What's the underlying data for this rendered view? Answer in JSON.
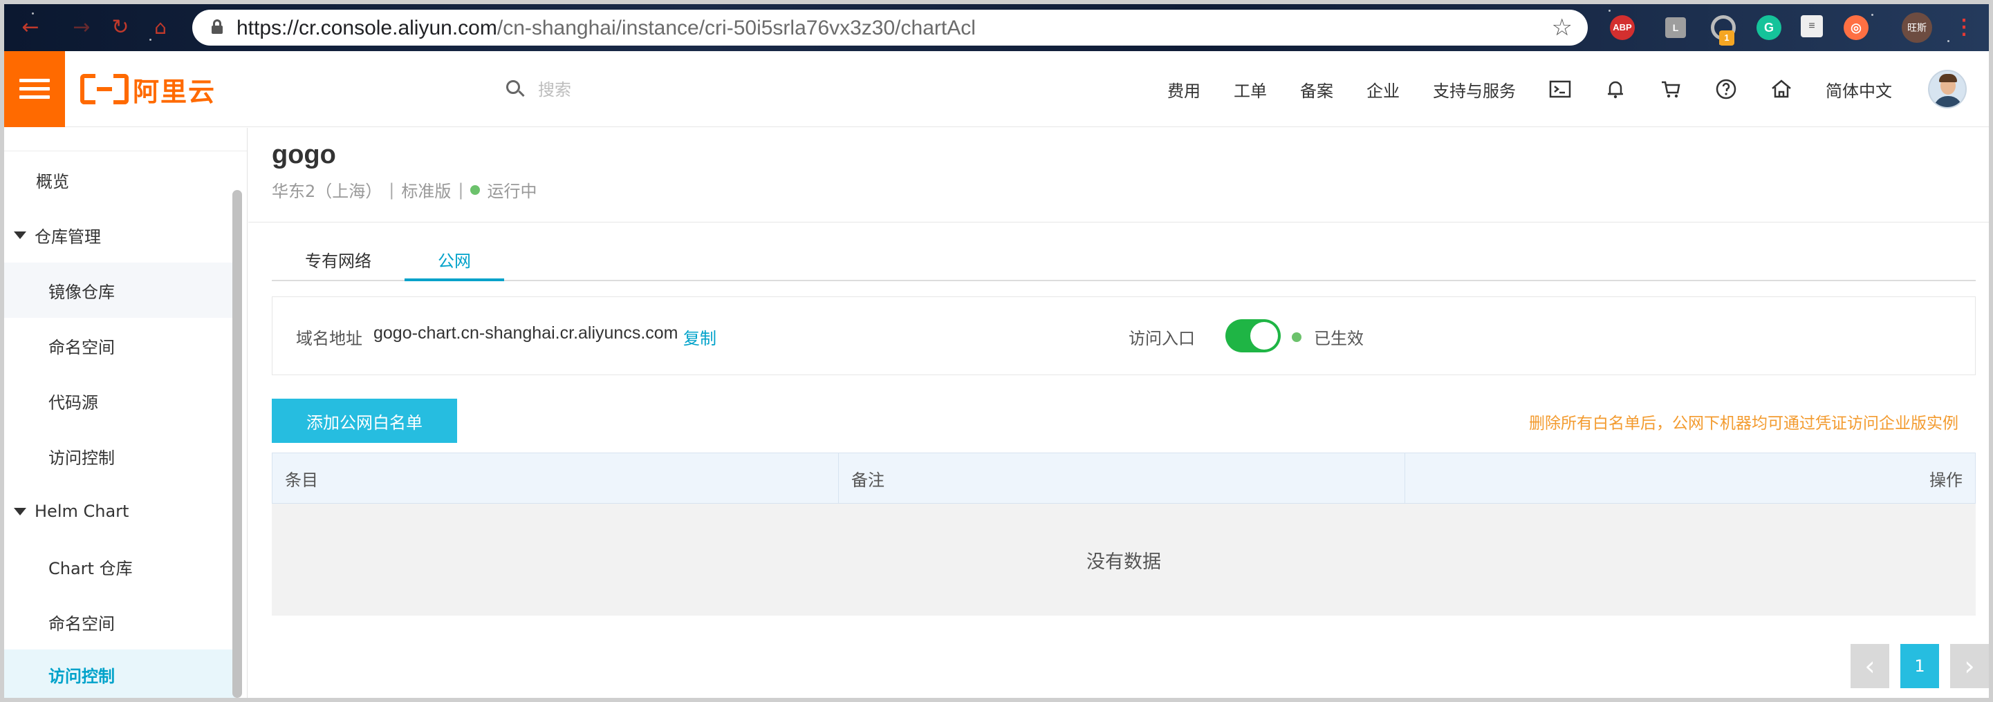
{
  "browser": {
    "url_host": "https://cr.console.aliyun.com",
    "url_path": "/cn-shanghai/instance/cri-50i5srla76vx3z30/chartAcl",
    "extensions": [
      "ABP",
      "L",
      "G",
      "旺斯"
    ],
    "extension_badge": "1"
  },
  "header": {
    "logo_text": "阿里云",
    "search_placeholder": "搜索",
    "nav": [
      "费用",
      "工单",
      "备案",
      "企业",
      "支持与服务"
    ],
    "language": "简体中文",
    "icons": [
      "terminal-icon",
      "bell-icon",
      "cart-icon",
      "help-icon",
      "home-icon"
    ]
  },
  "sidebar": {
    "overview": "概览",
    "group_repo": "仓库管理",
    "repo_items": [
      "镜像仓库",
      "命名空间",
      "代码源",
      "访问控制"
    ],
    "group_helm": "Helm Chart",
    "helm_items": [
      "Chart 仓库",
      "命名空间",
      "访问控制"
    ]
  },
  "instance": {
    "name": "gogo",
    "region": "华东2（上海）",
    "edition": "标准版",
    "status": "运行中",
    "status_color": "#6cc26c"
  },
  "tabs": [
    "专有网络",
    "公网"
  ],
  "active_tab": "公网",
  "endpoint": {
    "label": "域名地址",
    "domain": "gogo-chart.cn-shanghai.cr.aliyuncs.com",
    "copy": "复制",
    "access_label": "访问入口",
    "access_enabled": true,
    "effective": "已生效"
  },
  "whitelist": {
    "add_button": "添加公网白名单",
    "warning": "删除所有白名单后，公网下机器均可通过凭证访问企业版实例",
    "columns": [
      "条目",
      "备注",
      "操作"
    ],
    "empty": "没有数据"
  },
  "pagination": {
    "current": "1"
  },
  "colors": {
    "brand": "#ff6a00",
    "accent": "#00a2ca",
    "button": "#26bde0",
    "warning": "#f39b2f",
    "toggle_on": "#1fb545"
  }
}
